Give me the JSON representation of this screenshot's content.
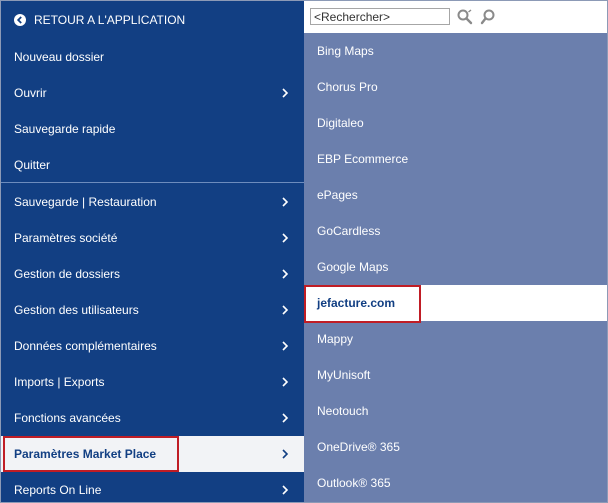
{
  "left_menu": {
    "back_label": "RETOUR A L'APPLICATION",
    "items": [
      {
        "label": "Nouveau dossier"
      },
      {
        "label": "Ouvrir"
      },
      {
        "label": "Sauvegarde rapide"
      },
      {
        "label": "Quitter"
      },
      {
        "label": "Sauvegarde | Restauration"
      },
      {
        "label": "Paramètres société"
      },
      {
        "label": "Gestion de dossiers"
      },
      {
        "label": "Gestion des utilisateurs"
      },
      {
        "label": "Données complémentaires"
      },
      {
        "label": "Imports | Exports"
      },
      {
        "label": "Fonctions avancées"
      },
      {
        "label": "Paramètres Market Place"
      },
      {
        "label": "Reports On Line"
      }
    ]
  },
  "search": {
    "placeholder": "<Rechercher>"
  },
  "right_panel": {
    "items": [
      {
        "label": "Bing Maps"
      },
      {
        "label": "Chorus Pro"
      },
      {
        "label": "Digitaleo"
      },
      {
        "label": "EBP Ecommerce"
      },
      {
        "label": "ePages"
      },
      {
        "label": "GoCardless"
      },
      {
        "label": "Google Maps"
      },
      {
        "label": "jefacture.com"
      },
      {
        "label": "Mappy"
      },
      {
        "label": "MyUnisoft"
      },
      {
        "label": "Neotouch"
      },
      {
        "label": "OneDrive® 365"
      },
      {
        "label": "Outlook® 365"
      }
    ]
  },
  "colors": {
    "menu_bg": "#123f83",
    "panel_bg": "#6b7fad",
    "highlight_border": "#c01d25",
    "selected_bg": "#f2f3f6"
  }
}
